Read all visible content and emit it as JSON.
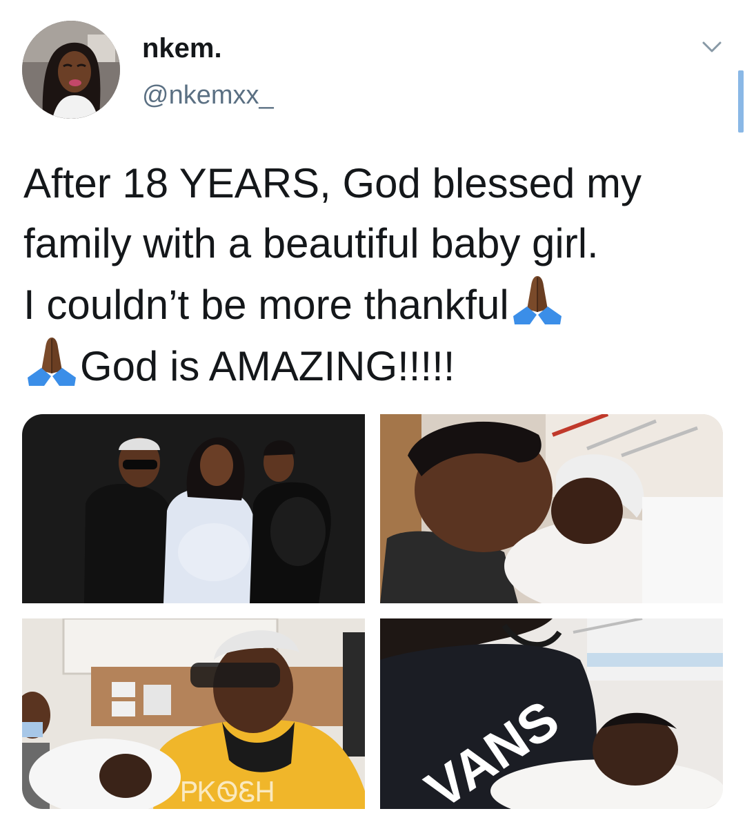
{
  "author": {
    "display_name": "nkem.",
    "handle": "@nkemxx_"
  },
  "tweet": {
    "lines": [
      "After 18 YEARS, God blessed my",
      "family with a beautiful baby girl.",
      "I couldn’t be more thankful",
      "God is AMAZING!!!!!"
    ],
    "emoji": "folded-hands-dark-skin-tone"
  },
  "media": {
    "photos": [
      {
        "icon": "family-portrait-photo"
      },
      {
        "icon": "mother-kissing-newborn-photo"
      },
      {
        "icon": "father-holding-newborn-photo"
      },
      {
        "icon": "sister-holding-newborn-photo",
        "text": "VANS"
      }
    ]
  },
  "colors": {
    "text": "#14171a",
    "secondary_text": "#5b7083",
    "chevron": "#8899a6",
    "emoji_skin": "#7a4a2a",
    "emoji_cuff": "#3b8ee8"
  }
}
